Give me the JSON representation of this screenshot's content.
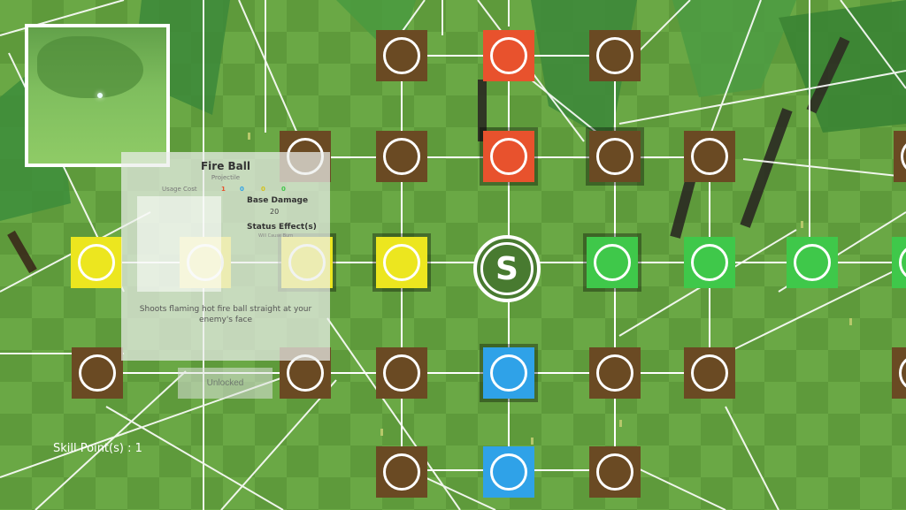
{
  "colors": {
    "brown": "#6a4a23",
    "red": "#e8522d",
    "yellow": "#ece61f",
    "green": "#3fc84a",
    "blue": "#2fa2e8",
    "start": "#487a30"
  },
  "start_node": {
    "label": "S"
  },
  "skill_info": {
    "name": "Fire Ball",
    "type": "Projectile",
    "usage_cost_label": "Usage Cost",
    "usage_costs": [
      "1",
      "0",
      "0",
      "0"
    ],
    "base_damage_label": "Base Damage",
    "base_damage_value": "20",
    "status_effects_label": "Status Effect(s)",
    "status_effects_value": "Will Cause Burn",
    "description": "Shoots flaming hot fire ball straight at your enemy's face"
  },
  "unlock_button": {
    "label": "Unlocked"
  },
  "skill_points": {
    "text": "Skill Point(s) : 1"
  }
}
